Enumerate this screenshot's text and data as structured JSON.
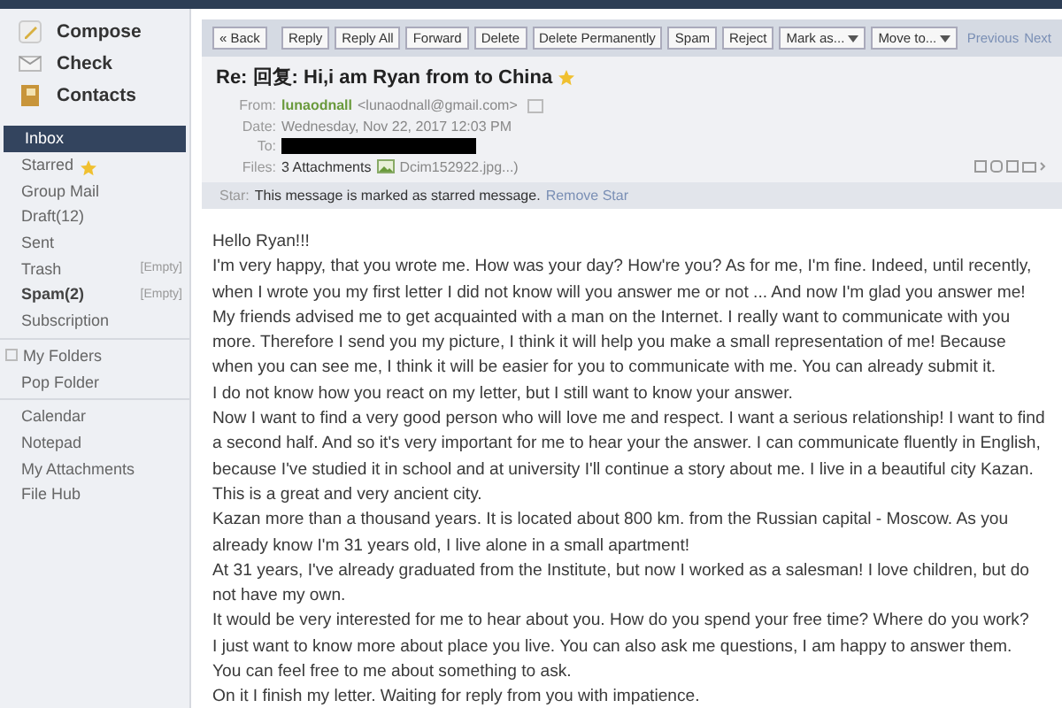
{
  "sidebar": {
    "actions": [
      {
        "label": "Compose",
        "kind": "compose"
      },
      {
        "label": "Check",
        "kind": "check"
      },
      {
        "label": "Contacts",
        "kind": "contacts"
      }
    ],
    "groups": [
      [
        {
          "label": "Inbox",
          "selected": true,
          "bold": false
        },
        {
          "label": "Starred",
          "selected": false,
          "bold": false,
          "starred": true
        },
        {
          "label": "Group Mail",
          "selected": false,
          "bold": false
        },
        {
          "label": "Draft(12)",
          "selected": false,
          "bold": false
        },
        {
          "label": "Sent",
          "selected": false,
          "bold": false
        },
        {
          "label": "Trash",
          "selected": false,
          "bold": false,
          "action": "[Empty]"
        },
        {
          "label": "Spam(2)",
          "selected": false,
          "bold": true,
          "action": "[Empty]"
        },
        {
          "label": "Subscription",
          "selected": false,
          "bold": false
        }
      ],
      [
        {
          "label": "My Folders",
          "selected": false,
          "bold": false,
          "toggle": true
        },
        {
          "label": "Pop Folder",
          "selected": false,
          "bold": false
        }
      ],
      [
        {
          "label": "Calendar",
          "selected": false,
          "bold": false
        },
        {
          "label": "Notepad",
          "selected": false,
          "bold": false
        },
        {
          "label": "My Attachments",
          "selected": false,
          "bold": false
        },
        {
          "label": "File Hub",
          "selected": false,
          "bold": false
        }
      ]
    ]
  },
  "toolbar": {
    "buttons": [
      {
        "label": "« Back",
        "dropdown": false
      },
      {
        "label": "Reply",
        "dropdown": false
      },
      {
        "label": "Reply All",
        "dropdown": false
      },
      {
        "label": "Forward",
        "dropdown": false
      },
      {
        "label": "Delete",
        "dropdown": false
      },
      {
        "label": "Delete Permanently",
        "dropdown": false
      },
      {
        "label": "Spam",
        "dropdown": false
      },
      {
        "label": "Reject",
        "dropdown": false
      },
      {
        "label": "Mark as...",
        "dropdown": true
      },
      {
        "label": "Move to...",
        "dropdown": true
      }
    ],
    "pager": [
      "Previous",
      "Next"
    ]
  },
  "message": {
    "subject": "Re: 回复:  Hi,i am Ryan from to China",
    "starred": true,
    "fields": [
      {
        "label": "From:",
        "kind": "sender",
        "name": "lunaodnall",
        "address": "<lunaodnall@gmail.com>"
      },
      {
        "label": "Date:",
        "kind": "text",
        "value": "Wednesday, Nov 22, 2017 12:03 PM"
      },
      {
        "label": "To:",
        "kind": "redacted"
      },
      {
        "label": "Files:",
        "kind": "files",
        "count": "3 Attachments",
        "file": "Dcim152922.jpg...)"
      }
    ],
    "star_notice": {
      "label": "Star:",
      "text": "This message is marked as starred message.",
      "link": "Remove Star"
    },
    "body": [
      "Hello Ryan!!!",
      "I'm very happy, that you wrote me. How was your day? How're you? As for me, I'm fine. Indeed, until recently,",
      "when I wrote you my first letter I did not know will you answer me or not ... And now I'm glad you answer me!",
      "My friends advised me to get acquainted with a man on the Internet. I really want to communicate with you",
      "more. Therefore I send you my picture, I think it will help you make a small representation of me! Because",
      "when you can see me, I think it will be easier for you to communicate with me. You can already submit it.",
      "I do not know how you react on my letter, but I still want to know your answer.",
      "Now I want to find a very good person who will love me and respect. I want a serious relationship! I want to find",
      "a second half. And so it's very important for me to hear your the answer. I can communicate fluently in English,",
      "because I've studied it in school and at university I'll continue a story about me. I live in a beautiful city Kazan.",
      "This is a great and very ancient city.",
      "Kazan more than a thousand years. It is located about 800 km. from the Russian capital - Moscow. As you",
      "already know I'm 31 years old, I live alone in a small apartment!",
      "At 31 years, I've already graduated from the Institute, but now I worked as a salesman! I love children, but do",
      "not have my own.",
      "It would be very interested for me to hear about you. How do you spend your free time? Where do you work?",
      "I just want to know more about place you live. You can also ask me questions, I am happy to answer them.",
      "You can feel free to me about something to ask.",
      "On it I finish my letter.  Waiting for reply from you with impatience."
    ]
  }
}
